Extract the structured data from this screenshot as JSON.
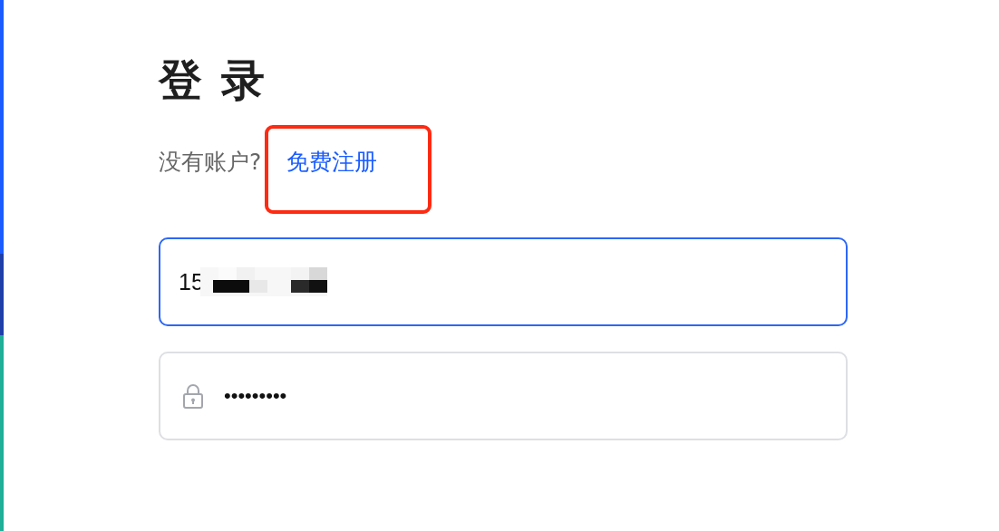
{
  "title": "登 录",
  "signup_prompt": {
    "text": "没有账户?",
    "link": "免费注册",
    "highlighted": true
  },
  "phone_field": {
    "value": "15",
    "focused": true,
    "redacted": true
  },
  "password_field": {
    "value": "•••••••••",
    "focused": false
  }
}
